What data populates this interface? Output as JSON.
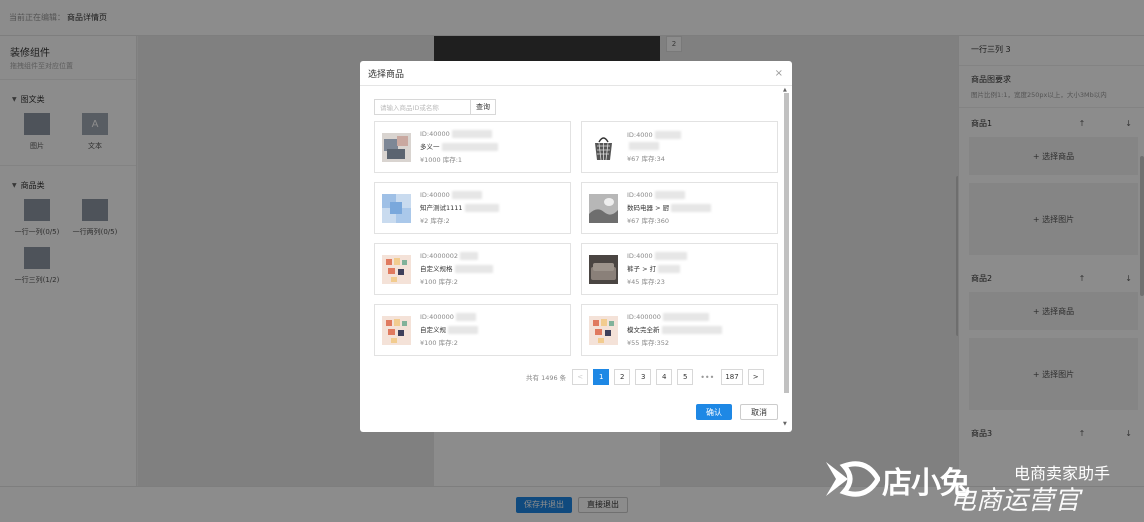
{
  "topbar": {
    "label": "当前正在编辑：",
    "current": "商品详情页"
  },
  "left": {
    "title": "装修组件",
    "subtitle": "拖拽组件至对应位置",
    "groups": [
      {
        "name": "图文类",
        "items": [
          {
            "label": "图片"
          },
          {
            "label": "文本"
          }
        ]
      },
      {
        "name": "商品类",
        "items": [
          {
            "label": "一行一列(0/5)"
          },
          {
            "label": "一行两列(0/5)"
          },
          {
            "label": "一行三列(1/2)"
          }
        ]
      }
    ]
  },
  "canvas": {
    "index_badge": "2"
  },
  "right": {
    "title": "一行三列 3",
    "req_title": "商品图要求",
    "req_sub": "图片比例1:1，宽度250px以上，大小3Mb以内",
    "products": [
      {
        "label": "商品1",
        "select_product": "+ 选择商品",
        "select_image": "+ 选择图片"
      },
      {
        "label": "商品2",
        "select_product": "+ 选择商品",
        "select_image": "+ 选择图片"
      },
      {
        "label": "商品3"
      }
    ]
  },
  "bottom": {
    "save": "保存并退出",
    "exit": "直接退出"
  },
  "modal": {
    "title": "选择商品",
    "search_placeholder": "请输入商品ID或名称",
    "search_button": "查询",
    "cards": [
      {
        "id": "ID:40000",
        "name": "多义一",
        "price": "¥1000 库存:1"
      },
      {
        "id": "ID:4000",
        "name": "",
        "price": "¥67 库存:34"
      },
      {
        "id": "ID:40000",
        "name": "知产测试1111",
        "price": "¥2 库存:2"
      },
      {
        "id": "ID:4000",
        "name": "数码电器 > 厨",
        "price": "¥67 库存:360"
      },
      {
        "id": "ID:4000002",
        "name": "自定义规格",
        "price": "¥100 库存:2"
      },
      {
        "id": "ID:4000",
        "name": "裤子 > 打",
        "price": "¥45 库存:23"
      },
      {
        "id": "ID:400000",
        "name": "自定义规",
        "price": "¥100 库存:2"
      },
      {
        "id": "ID:400000",
        "name": "模文完全新",
        "price": "¥55 库存:352"
      }
    ],
    "pager": {
      "total": "共有 1496 条",
      "prev": "<",
      "pages": [
        "1",
        "2",
        "3",
        "4",
        "5"
      ],
      "dots": "•••",
      "last": "187",
      "next": ">"
    },
    "confirm": "确认",
    "cancel": "取消",
    "close": "×"
  },
  "watermark": {
    "brand": "店小兔",
    "sub1": "电商卖家助手",
    "sub2": "电商运营官"
  }
}
